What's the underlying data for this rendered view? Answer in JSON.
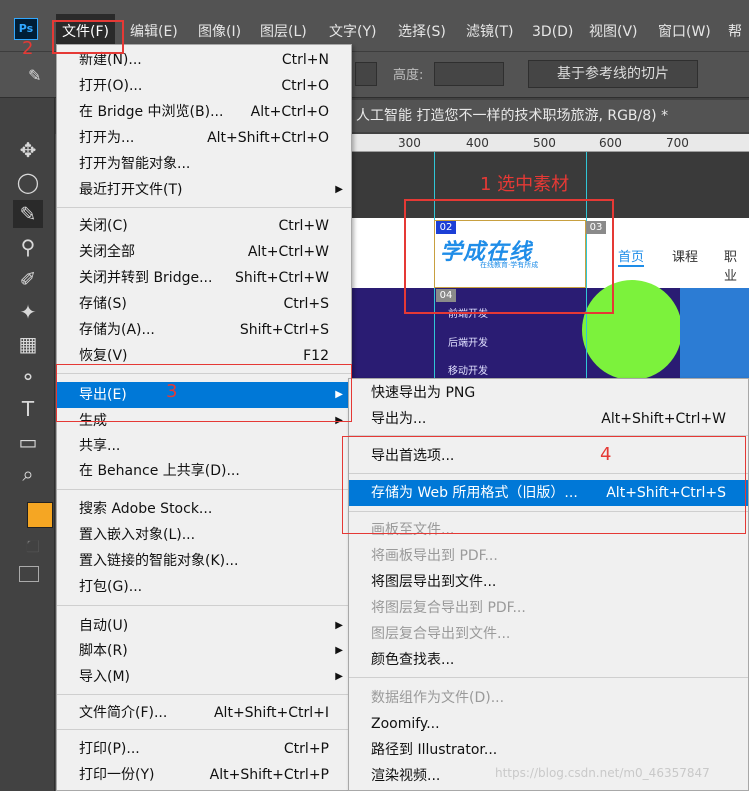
{
  "app": {
    "logo": "Ps"
  },
  "menubar": {
    "items": [
      "文件(F)",
      "编辑(E)",
      "图像(I)",
      "图层(L)",
      "文字(Y)",
      "选择(S)",
      "滤镜(T)",
      "3D(D)",
      "视图(V)",
      "窗口(W)",
      "帮"
    ]
  },
  "options": {
    "height_label": "高度:",
    "slice_button": "基于参考线的切片"
  },
  "document": {
    "tab_title": "人工智能  打造您不一样的技术职场旅游, RGB/8) *",
    "ruler": [
      "300",
      "400",
      "500",
      "600",
      "700"
    ]
  },
  "website": {
    "logo": "学成在线",
    "logo_sub": "在线教育·学有所成",
    "nav": [
      "首页",
      "课程",
      "职业"
    ],
    "side_menu": [
      "前端开发",
      "后端开发",
      "移动开发"
    ],
    "slice_labels": [
      "02",
      "03",
      "04"
    ]
  },
  "file_menu": {
    "items": [
      {
        "label": "新建(N)...",
        "shortcut": "Ctrl+N"
      },
      {
        "label": "打开(O)...",
        "shortcut": "Ctrl+O"
      },
      {
        "label": "在 Bridge 中浏览(B)...",
        "shortcut": "Alt+Ctrl+O"
      },
      {
        "label": "打开为...",
        "shortcut": "Alt+Shift+Ctrl+O"
      },
      {
        "label": "打开为智能对象...",
        "shortcut": ""
      },
      {
        "label": "最近打开文件(T)",
        "shortcut": ""
      },
      {
        "label": "关闭(C)",
        "shortcut": "Ctrl+W"
      },
      {
        "label": "关闭全部",
        "shortcut": "Alt+Ctrl+W"
      },
      {
        "label": "关闭并转到 Bridge...",
        "shortcut": "Shift+Ctrl+W"
      },
      {
        "label": "存储(S)",
        "shortcut": "Ctrl+S"
      },
      {
        "label": "存储为(A)...",
        "shortcut": "Shift+Ctrl+S"
      },
      {
        "label": "恢复(V)",
        "shortcut": "F12"
      },
      {
        "label": "导出(E)",
        "shortcut": ""
      },
      {
        "label": "生成",
        "shortcut": ""
      },
      {
        "label": "共享...",
        "shortcut": ""
      },
      {
        "label": "在 Behance 上共享(D)...",
        "shortcut": ""
      },
      {
        "label": "搜索 Adobe Stock...",
        "shortcut": ""
      },
      {
        "label": "置入嵌入对象(L)...",
        "shortcut": ""
      },
      {
        "label": "置入链接的智能对象(K)...",
        "shortcut": ""
      },
      {
        "label": "打包(G)...",
        "shortcut": ""
      },
      {
        "label": "自动(U)",
        "shortcut": ""
      },
      {
        "label": "脚本(R)",
        "shortcut": ""
      },
      {
        "label": "导入(M)",
        "shortcut": ""
      },
      {
        "label": "文件简介(F)...",
        "shortcut": "Alt+Shift+Ctrl+I"
      },
      {
        "label": "打印(P)...",
        "shortcut": "Ctrl+P"
      },
      {
        "label": "打印一份(Y)",
        "shortcut": "Alt+Shift+Ctrl+P"
      }
    ]
  },
  "export_menu": {
    "items": [
      {
        "label": "快速导出为 PNG",
        "shortcut": ""
      },
      {
        "label": "导出为...",
        "shortcut": "Alt+Shift+Ctrl+W"
      },
      {
        "label": "导出首选项...",
        "shortcut": ""
      },
      {
        "label": "存储为 Web 所用格式（旧版）...",
        "shortcut": "Alt+Shift+Ctrl+S"
      },
      {
        "label": "画板至文件...",
        "shortcut": ""
      },
      {
        "label": "将画板导出到 PDF...",
        "shortcut": ""
      },
      {
        "label": "将图层导出到文件...",
        "shortcut": ""
      },
      {
        "label": "将图层复合导出到 PDF...",
        "shortcut": ""
      },
      {
        "label": "图层复合导出到文件...",
        "shortcut": ""
      },
      {
        "label": "颜色查找表...",
        "shortcut": ""
      },
      {
        "label": "数据组作为文件(D)...",
        "shortcut": ""
      },
      {
        "label": "Zoomify...",
        "shortcut": ""
      },
      {
        "label": "路径到 Illustrator...",
        "shortcut": ""
      },
      {
        "label": "渲染视频...",
        "shortcut": ""
      }
    ]
  },
  "annotations": {
    "n1": "1 选中素材",
    "n2": "2",
    "n3": "3",
    "n4": "4"
  },
  "watermark": "https://blog.csdn.net/m0_46357847",
  "colors": {
    "highlight": "#0078d7",
    "annotation": "#e53935",
    "foreground": "#f5a623"
  }
}
